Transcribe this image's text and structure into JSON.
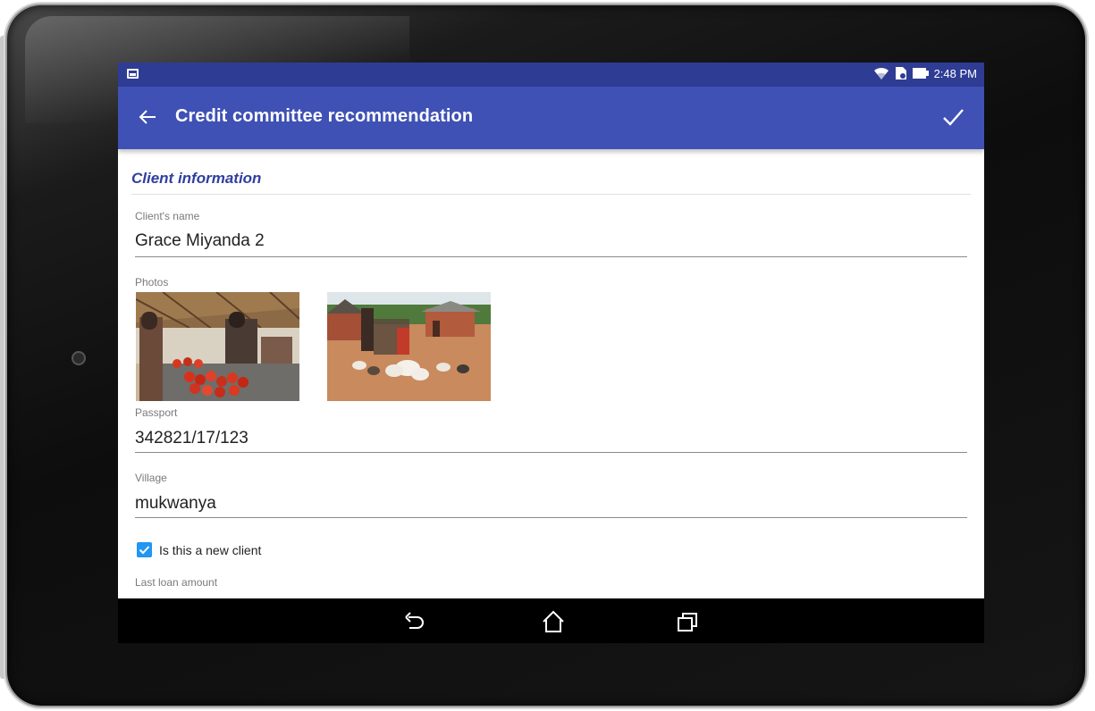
{
  "status_bar": {
    "time": "2:48 PM",
    "icons": [
      "image-notification-icon",
      "wifi-icon",
      "sim-icon",
      "battery-icon"
    ]
  },
  "app_bar": {
    "title": "Credit committee recommendation",
    "back_icon": "arrow-left-icon",
    "confirm_icon": "check-icon"
  },
  "form": {
    "section_title": "Client information",
    "client_name": {
      "label": "Client's name",
      "value": "Grace Miyanda 2"
    },
    "photos": {
      "label": "Photos",
      "items": [
        "market-stall-photo",
        "village-chickens-photo"
      ]
    },
    "passport": {
      "label": "Passport",
      "value": "342821/17/123"
    },
    "village": {
      "label": "Village",
      "value": "mukwanya"
    },
    "new_client": {
      "label": "Is this a new client",
      "checked": true
    },
    "last_loan_amount": {
      "label": "Last loan amount"
    }
  },
  "nav_bar": {
    "icons": [
      "back-nav-icon",
      "home-nav-icon",
      "recents-nav-icon"
    ]
  },
  "colors": {
    "status_bar": "#2f3c94",
    "app_bar": "#3f51b5",
    "section_title": "#303f9f",
    "checkbox": "#2196f3"
  }
}
